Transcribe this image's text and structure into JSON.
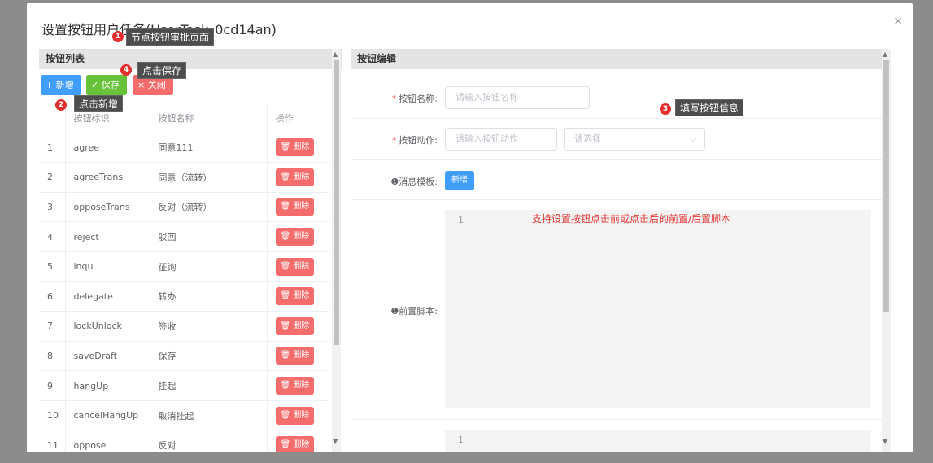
{
  "dialog": {
    "title": "设置按钮用户任务(UserTask_0cd14an)",
    "close": "×"
  },
  "left": {
    "header": "按钮列表",
    "buttons": {
      "add": "+ 新增",
      "save": "✓ 保存",
      "close": "× 关闭"
    },
    "columns": [
      "",
      "按钮标识",
      "按钮名称",
      "操作"
    ],
    "rows": [
      {
        "idx": "1",
        "key": "agree",
        "name": "同意111",
        "op": "删除"
      },
      {
        "idx": "2",
        "key": "agreeTrans",
        "name": "同意（流转）",
        "op": "删除"
      },
      {
        "idx": "3",
        "key": "opposeTrans",
        "name": "反对（流转）",
        "op": "删除"
      },
      {
        "idx": "4",
        "key": "reject",
        "name": "驳回",
        "op": "删除"
      },
      {
        "idx": "5",
        "key": "inqu",
        "name": "征询",
        "op": "删除"
      },
      {
        "idx": "6",
        "key": "delegate",
        "name": "转办",
        "op": "删除"
      },
      {
        "idx": "7",
        "key": "lockUnlock",
        "name": "签收",
        "op": "删除"
      },
      {
        "idx": "8",
        "key": "saveDraft",
        "name": "保存",
        "op": "删除"
      },
      {
        "idx": "9",
        "key": "hangUp",
        "name": "挂起",
        "op": "删除"
      },
      {
        "idx": "10",
        "key": "cancelHangUp",
        "name": "取消挂起",
        "op": "删除"
      },
      {
        "idx": "11",
        "key": "oppose",
        "name": "反对",
        "op": "删除"
      }
    ]
  },
  "right": {
    "header": "按钮编辑",
    "name_label": "按钮名称:",
    "name_placeholder": "请输入按钮名称",
    "action_label": "按钮动作:",
    "action_placeholder": "请输入按钮动作",
    "action_select": "请选择",
    "template_label": "❶消息模板:",
    "template_button": "新增",
    "pre_script_label": "❶前置脚本:",
    "line1": "1",
    "line1b": "1"
  },
  "annotations": {
    "a1": {
      "num": "1",
      "text": "节点按钮审批页面"
    },
    "a2": {
      "num": "2",
      "text": "点击新增"
    },
    "a3": {
      "num": "3",
      "text": "填写按钮信息"
    },
    "a4": {
      "num": "4",
      "text": "点击保存"
    },
    "note": "支持设置按钮点击前或点击后的前置/后置脚本"
  },
  "colors": {
    "primary": "#409eff",
    "success": "#67c23a",
    "danger": "#f56c6c",
    "annotation": "#e52e2e"
  }
}
